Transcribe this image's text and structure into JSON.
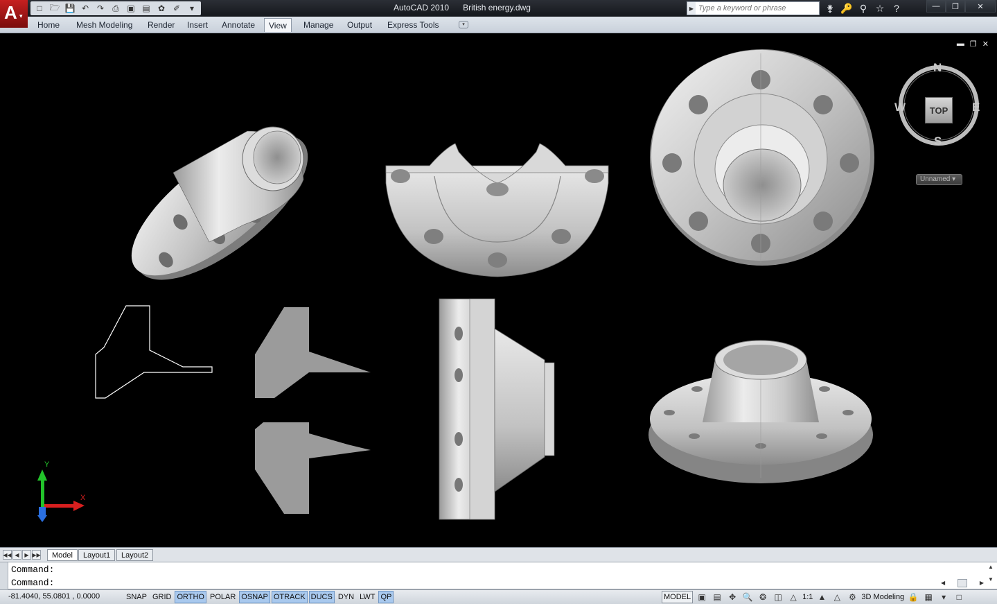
{
  "app": {
    "product": "AutoCAD 2010",
    "document": "British energy.dwg"
  },
  "search": {
    "placeholder": "Type a keyword or phrase"
  },
  "ribbon": {
    "tabs": [
      "Home",
      "Mesh Modeling",
      "Render",
      "Insert",
      "Annotate",
      "View",
      "Manage",
      "Output",
      "Express Tools"
    ],
    "active_tab": "View"
  },
  "viewcube": {
    "north": "N",
    "south": "S",
    "east": "E",
    "west": "W",
    "face": "TOP",
    "named_view": "Unnamed"
  },
  "ucs": {
    "x_label": "X",
    "y_label": "Y"
  },
  "layouts": {
    "tabs": [
      "Model",
      "Layout1",
      "Layout2"
    ],
    "active": "Model"
  },
  "command": {
    "line1": "Command:",
    "line2": "Command:"
  },
  "status": {
    "coordinates": "-81.4040,  55.0801 , 0.0000",
    "toggles": [
      {
        "label": "SNAP",
        "on": false
      },
      {
        "label": "GRID",
        "on": false
      },
      {
        "label": "ORTHO",
        "on": true
      },
      {
        "label": "POLAR",
        "on": false
      },
      {
        "label": "OSNAP",
        "on": true
      },
      {
        "label": "OTRACK",
        "on": true
      },
      {
        "label": "DUCS",
        "on": true
      },
      {
        "label": "DYN",
        "on": false
      },
      {
        "label": "LWT",
        "on": false
      },
      {
        "label": "QP",
        "on": true
      }
    ],
    "space": "MODEL",
    "annotation_scale": "1:1",
    "workspace": "3D Modeling"
  },
  "colors": {
    "model_space": "#000000",
    "solid_light": "#e6e6e6",
    "solid_dark": "#7a7a7a",
    "ucs_y": "#22c32a",
    "ucs_x": "#d81f1f",
    "ucs_z": "#2a6fe0"
  }
}
